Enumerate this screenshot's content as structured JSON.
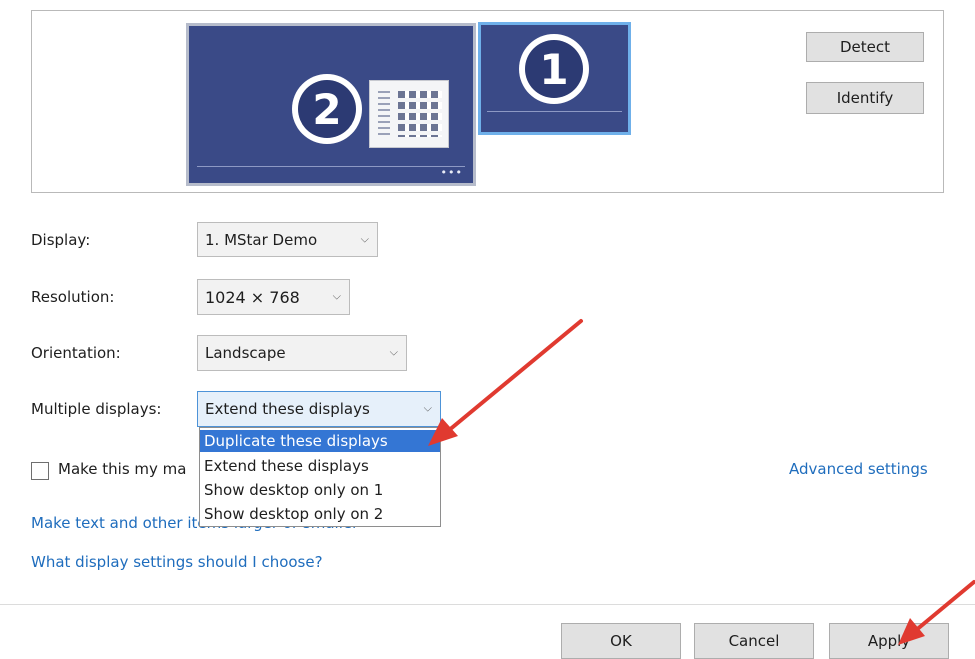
{
  "preview": {
    "monitor_2_number": "2",
    "monitor_1_number": "1",
    "detect_label": "Detect",
    "identify_label": "Identify"
  },
  "settings": {
    "display_label": "Display:",
    "display_value": "1. MStar Demo",
    "resolution_label": "Resolution:",
    "resolution_value": "1024 × 768",
    "orientation_label": "Orientation:",
    "orientation_value": "Landscape",
    "multiple_label": "Multiple displays:",
    "multiple_value": "Extend these displays",
    "multiple_options": [
      "Duplicate these displays",
      "Extend these displays",
      "Show desktop only on 1",
      "Show desktop only on 2"
    ],
    "highlighted_option_index": 0
  },
  "main_display": {
    "checkbox_label": "Make this my ma",
    "checked": false
  },
  "links": {
    "advanced": "Advanced settings",
    "text_size": "Make text and other items larger or smaller",
    "what_settings": "What display settings should I choose?"
  },
  "footer": {
    "ok": "OK",
    "cancel": "Cancel",
    "apply": "Apply"
  },
  "colors": {
    "monitor_bg": "#3a4a87",
    "selected_monitor_border": "#6fb0ea",
    "link": "#1f6dbd",
    "dropdown_highlight": "#3476d4",
    "annotation_arrow": "#e03a30"
  }
}
